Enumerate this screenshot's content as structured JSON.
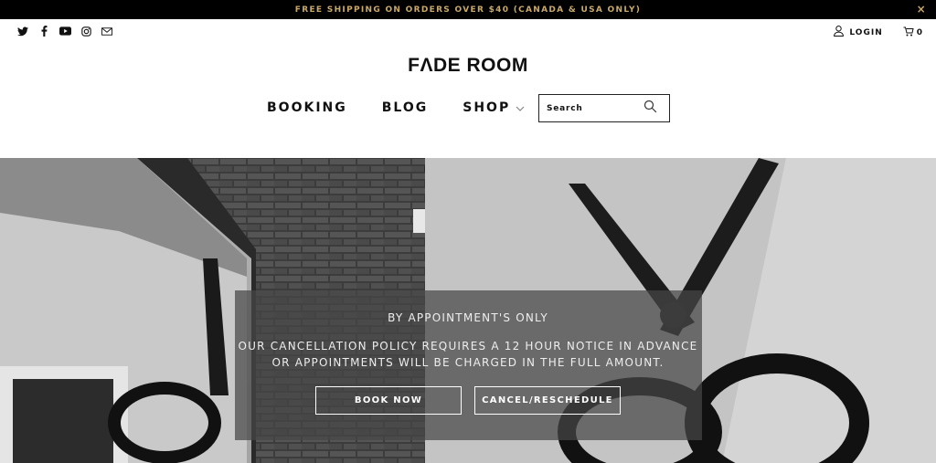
{
  "announcement": {
    "text": "FREE SHIPPING ON ORDERS OVER $40 (CANADA & USA ONLY)",
    "close_label": "×"
  },
  "social_icons": [
    "twitter-icon",
    "facebook-icon",
    "youtube-icon",
    "instagram-icon",
    "email-icon"
  ],
  "account": {
    "login_label": "LOGIN",
    "cart_count": "0"
  },
  "brand": {
    "logo": "FΛDE ROOM"
  },
  "nav": {
    "booking": "BOOKING",
    "blog": "BLOG",
    "shop": "SHOP"
  },
  "search": {
    "placeholder": "Search"
  },
  "hero": {
    "title": "BY APPOINTMENT'S ONLY",
    "policy_line1": "OUR CANCELLATION POLICY REQUIRES A 12 HOUR NOTICE IN ADVANCE",
    "policy_line2": "OR APPOINTMENTS WILL BE CHARGED IN THE FULL AMOUNT.",
    "book_label": "BOOK NOW",
    "cancel_label": "CANCEL/RESCHEDULE"
  },
  "colors": {
    "announce_bg": "#000000",
    "announce_text": "#c9a86a"
  }
}
